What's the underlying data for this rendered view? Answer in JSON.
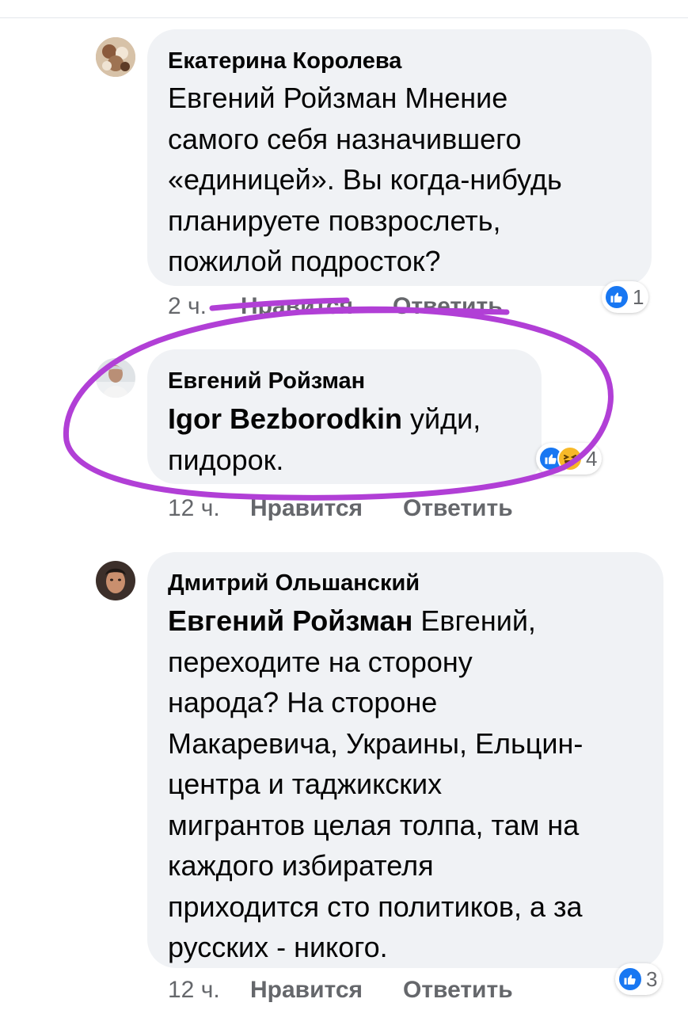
{
  "colors": {
    "bubble": "#f0f2f5",
    "meta_text": "#65676b",
    "like_blue": "#1877f2",
    "haha_yellow": "#f7b928",
    "annotation": "#b13fd6"
  },
  "comments": [
    {
      "author": "Екатерина Королева",
      "body_lines": [
        "Евгений Ройзман Мнение",
        "самого себя назначившего",
        "«единицей». Вы когда-нибудь",
        "планируете повзрослеть,",
        "пожилой подросток?"
      ],
      "time": "2 ч.",
      "like_label": "Нравится",
      "reply_label": "Ответить",
      "reaction_count": "1",
      "reaction_icons": [
        "like-icon"
      ]
    },
    {
      "author": "Евгений Ройзман",
      "mention": "Igor Bezborodkin",
      "body_first": " уйди,",
      "body_lines": [
        "пидорок."
      ],
      "time": "12 ч.",
      "like_label": "Нравится",
      "reply_label": "Ответить",
      "reaction_count": "4",
      "reaction_icons": [
        "like-icon",
        "haha-icon"
      ]
    },
    {
      "author": "Дмитрий Ольшанский",
      "mention": "Евгений Ройзман",
      "body_first": " Евгений,",
      "body_lines": [
        "переходите на сторону",
        "народа? На стороне",
        "Макаревича, Украины, Ельцин-",
        "центра и таджикских",
        "мигрантов целая толпа, там на",
        "каждого избирателя",
        "приходится сто политиков, а за",
        "русских - никого."
      ],
      "time": "12 ч.",
      "like_label": "Нравится",
      "reply_label": "Ответить",
      "reaction_count": "3",
      "reaction_icons": [
        "like-icon"
      ]
    }
  ]
}
